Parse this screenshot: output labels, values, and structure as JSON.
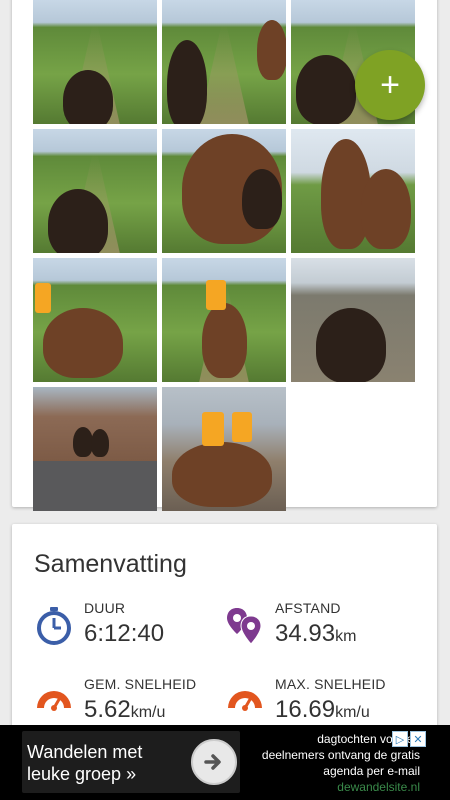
{
  "fab": {
    "label": "+"
  },
  "photos": [
    {
      "alt": "photo-1"
    },
    {
      "alt": "photo-2"
    },
    {
      "alt": "photo-3"
    },
    {
      "alt": "photo-4"
    },
    {
      "alt": "photo-5"
    },
    {
      "alt": "photo-6"
    },
    {
      "alt": "photo-7"
    },
    {
      "alt": "photo-8"
    },
    {
      "alt": "photo-9"
    },
    {
      "alt": "photo-10"
    },
    {
      "alt": "photo-11"
    }
  ],
  "summary": {
    "title": "Samenvatting",
    "stats": [
      {
        "label": "DUUR",
        "value": "6:12:40",
        "unit": "",
        "icon": "stopwatch-icon",
        "color": "#3b5ea8"
      },
      {
        "label": "AFSTAND",
        "value": "34.93",
        "unit": "km",
        "icon": "route-markers-icon",
        "color": "#7e3a8f"
      },
      {
        "label": "GEM. SNELHEID",
        "value": "5.62",
        "unit": "km/u",
        "icon": "speedometer-icon",
        "color": "#e2561f"
      },
      {
        "label": "MAX. SNELHEID",
        "value": "16.69",
        "unit": "km/u",
        "icon": "speedometer-icon",
        "color": "#e2561f"
      }
    ]
  },
  "ad": {
    "cta_line1": "Wandelen met",
    "cta_line2": "leuke groep »",
    "body_line1": "dagtochten voor en",
    "body_line2": "deelnemers ontvang de gratis",
    "body_line3": "agenda per e-mail",
    "domain": "dewandelsite.nl",
    "arrow_icon": "arrow-right-icon"
  }
}
